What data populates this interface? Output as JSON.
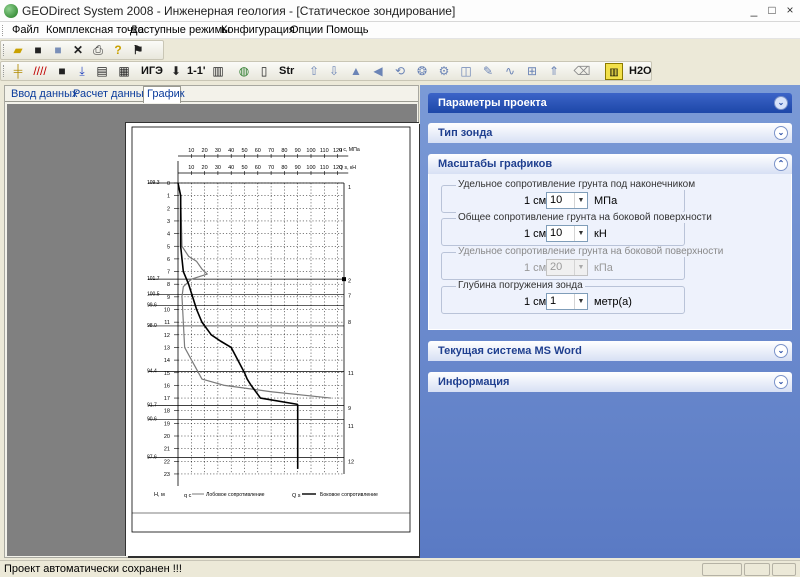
{
  "window": {
    "title": "GEODirect System 2008 - Инженерная геология - [Статическое зондирование]",
    "controls": [
      "_",
      "□",
      "×"
    ]
  },
  "menu": [
    "Файл",
    "Комплексная точка",
    "Доступные режимы",
    "Конфигурация",
    "Опции",
    "Помощь"
  ],
  "toolbar2_text": {
    "ige": "ИГЭ",
    "one_one": "1-1'",
    "str": "Str",
    "h2o": "H2O"
  },
  "tabs": [
    "Ввод данных",
    "Расчет данных",
    "График"
  ],
  "active_tab": "График",
  "chart": {
    "top_scale_values": [
      "10",
      "20",
      "30",
      "40",
      "50",
      "60",
      "70",
      "80",
      "90",
      "100",
      "110",
      "120"
    ],
    "top_scale_unit": "q c, МПа",
    "second_scale_values": [
      "10",
      "20",
      "30",
      "40",
      "50",
      "60",
      "70",
      "80",
      "90",
      "100",
      "110",
      "120"
    ],
    "second_scale_unit": "Q s, кН",
    "depth_ticks": [
      "0",
      "1",
      "2",
      "3",
      "4",
      "5",
      "6",
      "7",
      "8",
      "9",
      "10",
      "11",
      "12",
      "13",
      "14",
      "15",
      "16",
      "17",
      "18",
      "19",
      "20",
      "21",
      "22",
      "23"
    ],
    "elevations": [
      "109.3",
      "101.7",
      "100.5",
      "99.6",
      "98.0",
      "94.4",
      "91.7",
      "90.6",
      "87.6"
    ],
    "layer_numbers": [
      "1",
      "2",
      "7",
      "8",
      "11",
      "9",
      "11",
      "12"
    ],
    "footer_left": "H, м",
    "footer_qc": "q c",
    "footer_qs": "Q s",
    "footer_left_legend": "Лобовое сопротивление",
    "footer_right_legend": "Боковое сопротивление",
    "series": {
      "qc_mpa": {
        "depth_m": [
          0.0,
          0.5,
          1.0,
          3.0,
          5.0,
          6.0,
          7.0,
          8.0,
          9.0,
          10.0,
          11.0,
          12.0,
          12.5,
          13.0,
          14.0,
          15.0,
          15.5,
          16.0,
          17.0,
          17.5
        ],
        "values": [
          0,
          1,
          2,
          2,
          2,
          3,
          4,
          8,
          11,
          14,
          18,
          25,
          32,
          40,
          45,
          50,
          52,
          55,
          62,
          90
        ]
      },
      "qs_kn": {
        "depth_m": [
          0.0,
          1.0,
          5.0,
          5.8,
          6.2,
          6.8,
          7.2,
          7.6,
          8.2,
          9.0,
          13.0,
          15.5,
          16.0,
          16.5,
          17.0
        ],
        "values": [
          0,
          2,
          3,
          8,
          14,
          18,
          22,
          10,
          4,
          3,
          5,
          18,
          35,
          70,
          115
        ]
      }
    }
  },
  "panels": [
    {
      "title": "Параметры проекта",
      "state": "collapsed"
    },
    {
      "title": "Тип зонда",
      "state": "collapsed"
    },
    {
      "title": "Масштабы графиков",
      "state": "expanded"
    },
    {
      "title": "Текущая система MS Word",
      "state": "collapsed"
    },
    {
      "title": "Информация",
      "state": "collapsed"
    }
  ],
  "scales": {
    "group1": {
      "label": "Удельное сопротивление грунта под наконечником",
      "row_label": "1 см:",
      "value": "10",
      "unit": "МПа"
    },
    "group2": {
      "label": "Общее сопротивление грунта на боковой поверхности",
      "row_label": "1 см:",
      "value": "10",
      "unit": "кН"
    },
    "group3": {
      "label": "Удельное сопротивление грунта на боковой поверхности",
      "row_label": "1 см:",
      "value": "20",
      "unit": "кПа"
    },
    "group4": {
      "label": "Глубина погружения зонда",
      "row_label": "1 см:",
      "value": "1",
      "unit": "метр(а)"
    }
  },
  "status": {
    "message": "Проект автоматически сохранен !!!"
  }
}
